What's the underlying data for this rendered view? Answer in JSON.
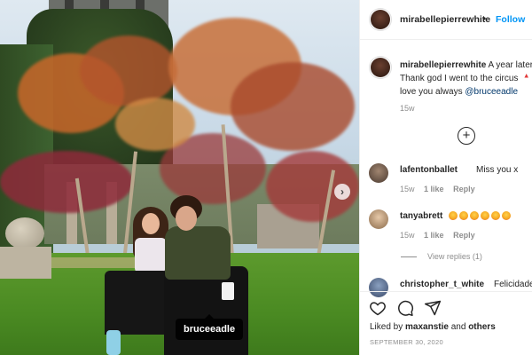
{
  "post": {
    "author": "mirabellepierrewhite",
    "follow_label": "Follow",
    "caption_line1": "A year later.",
    "caption_line2": "Thank god I went to the circus",
    "caption_line3": "love you always",
    "caption_mention": "@bruceeadle",
    "caption_age": "15w",
    "photo_tag": "bruceeadle"
  },
  "comments": [
    {
      "user": "lafentonballet",
      "text": "Miss you x",
      "age": "15w",
      "likes": "1 like",
      "reply": "Reply"
    },
    {
      "user": "tanyabrett",
      "text": "",
      "emoji_count": 6,
      "age": "15w",
      "likes": "1 like",
      "reply": "Reply",
      "view_replies": "View replies (1)"
    },
    {
      "user": "christopher_t_white",
      "text": "Felicidades"
    }
  ],
  "footer": {
    "liked_by": "Liked by",
    "liked_user": "maxanstie",
    "and_label": "and",
    "others_label": "others",
    "date": "SEPTEMBER 30, 2020"
  },
  "icons": [
    "heart-icon",
    "comment-icon",
    "share-icon",
    "plus-circle-icon",
    "chevron-right-icon"
  ],
  "colors": {
    "link_blue": "#0095f6",
    "mention_blue": "#00376b",
    "muted": "#8e8e8e",
    "text": "#262626"
  }
}
